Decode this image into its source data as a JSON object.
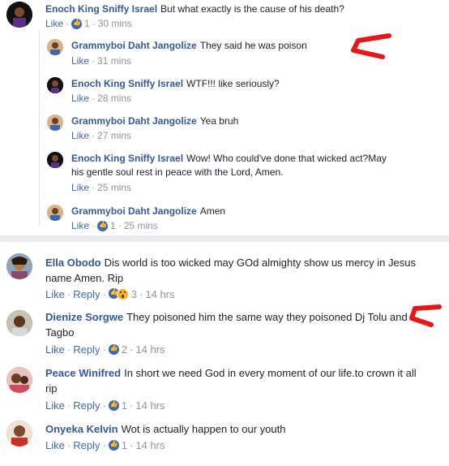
{
  "thread": {
    "main": {
      "author": "Enoch King Sniffy Israel",
      "text": "But what exactly is the cause of his death?",
      "like": "Like",
      "likes": "1",
      "time": "30 mins"
    },
    "replies": [
      {
        "author": "Grammyboi Daht Jangolize",
        "text": "They said he was poison",
        "like": "Like",
        "time": "31 mins"
      },
      {
        "author": "Enoch King Sniffy Israel",
        "text": "WTF!!! like seriously?",
        "like": "Like",
        "time": "28 mins"
      },
      {
        "author": "Grammyboi Daht Jangolize",
        "text": "Yea bruh",
        "like": "Like",
        "time": "27 mins"
      },
      {
        "author": "Enoch King Sniffy Israel",
        "text": "Wow! Who could've done that wicked act?May his gentle soul rest in peace with the Lord, Amen.",
        "like": "Like",
        "time": "25 mins"
      },
      {
        "author": "Grammyboi Daht Jangolize",
        "text": "Amen",
        "like": "Like",
        "likes": "1",
        "time": "25 mins"
      }
    ]
  },
  "comments": [
    {
      "author": "Ella Obodo",
      "text": "Dis world is too wicked may GOd almighty show us mercy in Jesus name Amen. Rip",
      "like": "Like",
      "reply": "Reply",
      "likes": "3",
      "time": "14 hrs"
    },
    {
      "author": "Dienize Sorgwe",
      "text": "They poisoned him the same way they poisoned Dj Tolu and Tagbo",
      "like": "Like",
      "reply": "Reply",
      "likes": "2",
      "time": "14 hrs"
    },
    {
      "author": "Peace Winifred",
      "text": "In short we need God in every moment of our life.to crown it all rip",
      "like": "Like",
      "reply": "Reply",
      "likes": "1",
      "time": "14 hrs"
    },
    {
      "author": "Onyeka Kelvin",
      "text": "Wot is actually happen to our youth",
      "like": "Like",
      "reply": "Reply",
      "likes": "1",
      "time": "14 hrs"
    }
  ],
  "colors": {
    "link": "#4267b2",
    "author": "#365899",
    "annotation_arrow": "#e0191a"
  }
}
